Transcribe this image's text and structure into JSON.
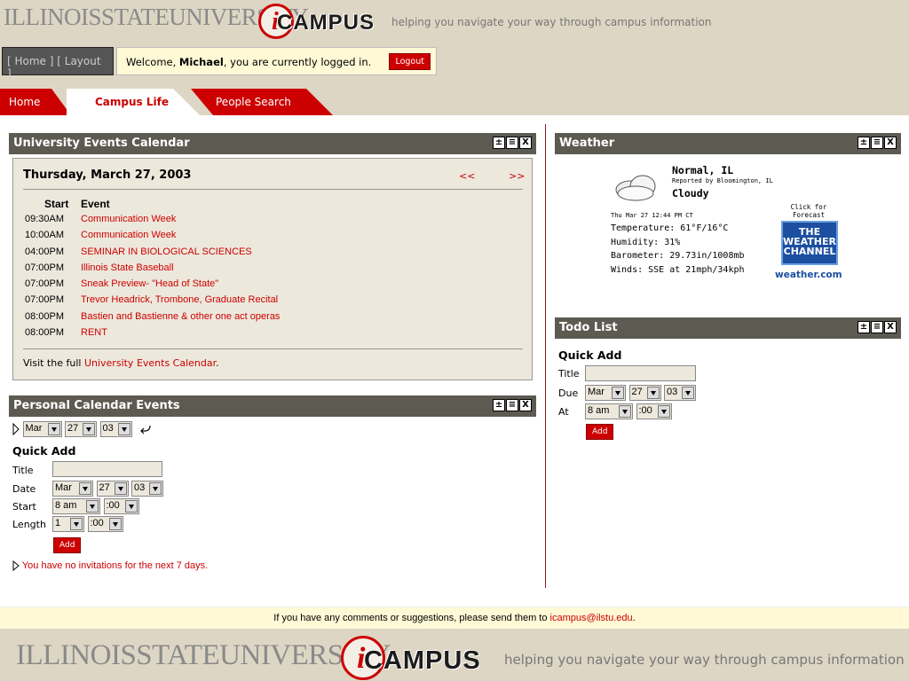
{
  "header": {
    "isu_logo": "ILLINOISSTATEUNIVERSITY",
    "icampus": "CAMPUS",
    "icampus_i": "i",
    "tagline": "helping you navigate your way through campus information"
  },
  "navlinks": {
    "home": "[ Home ]",
    "layout": "[ Layout ]"
  },
  "welcome": {
    "prefix": "Welcome, ",
    "user": "Michael",
    "suffix": ", you are currently logged in.",
    "logout": "Logout"
  },
  "tabs": [
    {
      "label": "Home"
    },
    {
      "label": "Campus Life"
    },
    {
      "label": "People Search"
    }
  ],
  "portlet_controls": [
    "±",
    "≡",
    "X"
  ],
  "events": {
    "title": "University Events Calendar",
    "date": "Thursday, March 27, 2003",
    "prev": "<<",
    "next": ">>",
    "col_start": "Start",
    "col_event": "Event",
    "rows": [
      {
        "time": "09:30AM",
        "event": "Communication Week"
      },
      {
        "time": "10:00AM",
        "event": "Communication Week"
      },
      {
        "time": "04:00PM",
        "event": "SEMINAR IN BIOLOGICAL SCIENCES"
      },
      {
        "time": "07:00PM",
        "event": "Illinois State Baseball"
      },
      {
        "time": "07:00PM",
        "event": "Sneak Preview- \"Head of State\""
      },
      {
        "time": "07:00PM",
        "event": "Trevor Headrick, Trombone, Graduate Recital"
      },
      {
        "time": "08:00PM",
        "event": "Bastien and Bastienne & other one act operas"
      },
      {
        "time": "08:00PM",
        "event": "RENT"
      }
    ],
    "footer_prefix": "Visit the full ",
    "footer_link": "University Events Calendar",
    "footer_suffix": "."
  },
  "personal": {
    "title": "Personal Calendar Events",
    "nav_month": "Mar",
    "nav_day": "27",
    "nav_year": "03",
    "quick_add": "Quick Add",
    "title_label": "Title",
    "date_label": "Date",
    "start_label": "Start",
    "length_label": "Length",
    "date_month": "Mar",
    "date_day": "27",
    "date_year": "03",
    "start_hour": "8 am",
    "start_min": ":00",
    "length_hour": "1",
    "length_min": ":00",
    "add": "Add",
    "invitations": "You have no invitations for the next 7 days."
  },
  "weather": {
    "title": "Weather",
    "city": "Normal, IL",
    "reported": "Reported by Bloomington, IL",
    "condition": "Cloudy",
    "time": "Thu Mar 27 12:44 PM CT",
    "temperature": "Temperature: 61°F/16°C",
    "humidity": "Humidity: 31%",
    "barometer": "Barometer: 29.73in/1008mb",
    "winds": "Winds: SSE at 21mph/34kph",
    "click_forecast": "Click for Forecast",
    "twc_line1": "THE",
    "twc_line2": "WEATHER",
    "twc_line3": "CHANNEL",
    "weather_com": "weather.com"
  },
  "todo": {
    "title": "Todo List",
    "quick_add": "Quick Add",
    "title_label": "Title",
    "due_label": "Due",
    "at_label": "At",
    "due_month": "Mar",
    "due_day": "27",
    "due_year": "03",
    "at_hour": "8 am",
    "at_min": ":00",
    "add": "Add"
  },
  "footer": {
    "prefix": "If you have any comments or suggestions, please send them to ",
    "email": "icampus@ilstu.edu",
    "suffix": "."
  },
  "colors": {
    "accent": "#cc0000",
    "header_bg": "#ded6c4",
    "portlet_head": "#5d5a52",
    "note_bg": "#fff9d6"
  }
}
